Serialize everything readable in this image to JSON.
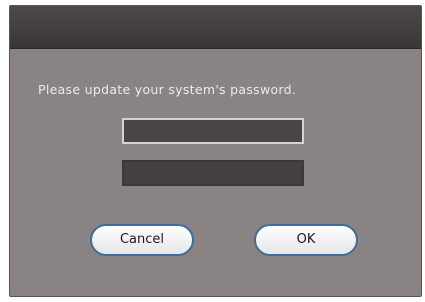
{
  "dialog": {
    "message": "Please update your system's password.",
    "password_field": {
      "value": ""
    },
    "confirm_field": {
      "value": ""
    },
    "cancel_label": "Cancel",
    "ok_label": "OK"
  }
}
